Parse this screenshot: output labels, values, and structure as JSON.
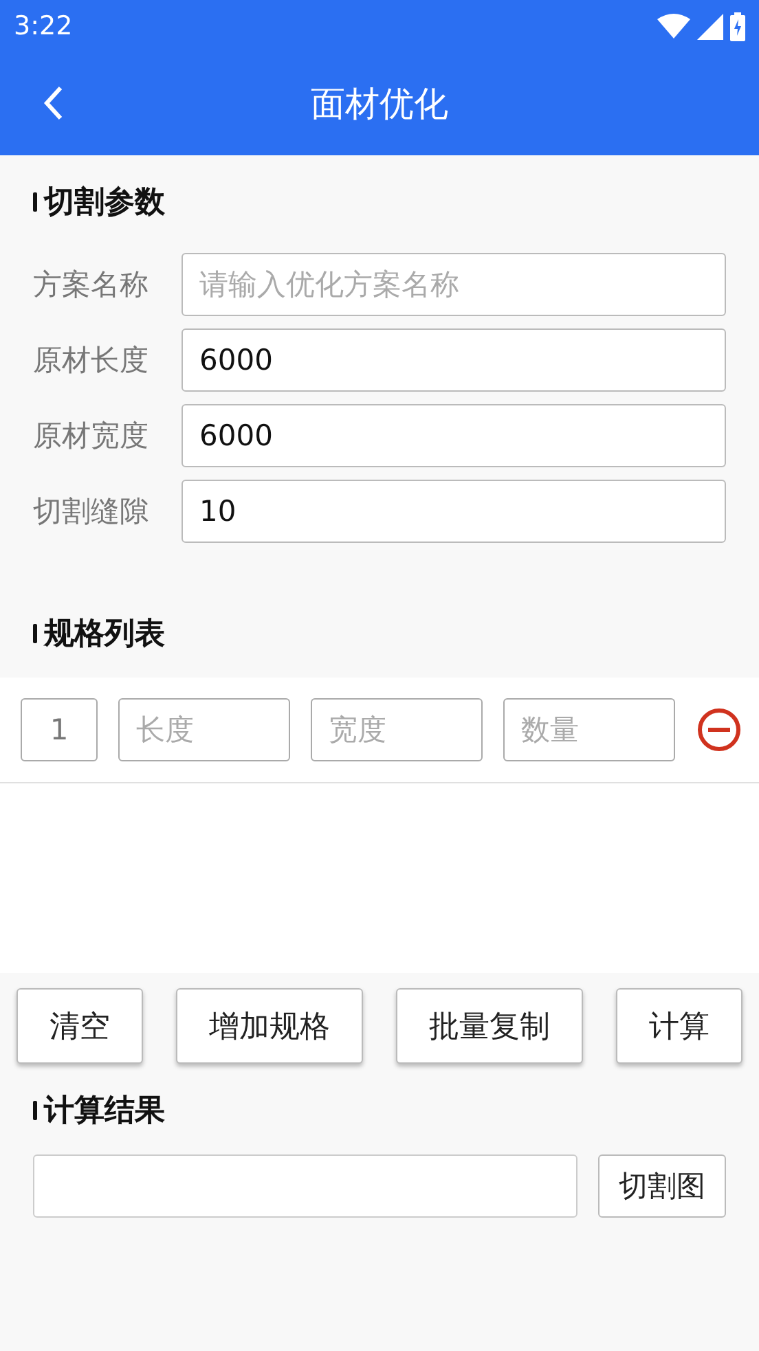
{
  "status_bar": {
    "time": "3:22"
  },
  "app_bar": {
    "title": "面材优化"
  },
  "cutting_params": {
    "heading": "切割参数",
    "fields": [
      {
        "label": "方案名称",
        "placeholder": "请输入优化方案名称"
      },
      {
        "label": "原材长度",
        "value": "6000"
      },
      {
        "label": "原材宽度",
        "value": "6000"
      },
      {
        "label": "切割缝隙",
        "value": "10"
      }
    ]
  },
  "spec_list": {
    "heading": "规格列表",
    "rows": [
      {
        "index": "1",
        "length_placeholder": "长度",
        "width_placeholder": "宽度",
        "quantity_placeholder": "数量"
      }
    ]
  },
  "actions": [
    "清空",
    "增加规格",
    "批量复制",
    "计算"
  ],
  "result": {
    "heading": "计算结果",
    "button": "切割图"
  }
}
